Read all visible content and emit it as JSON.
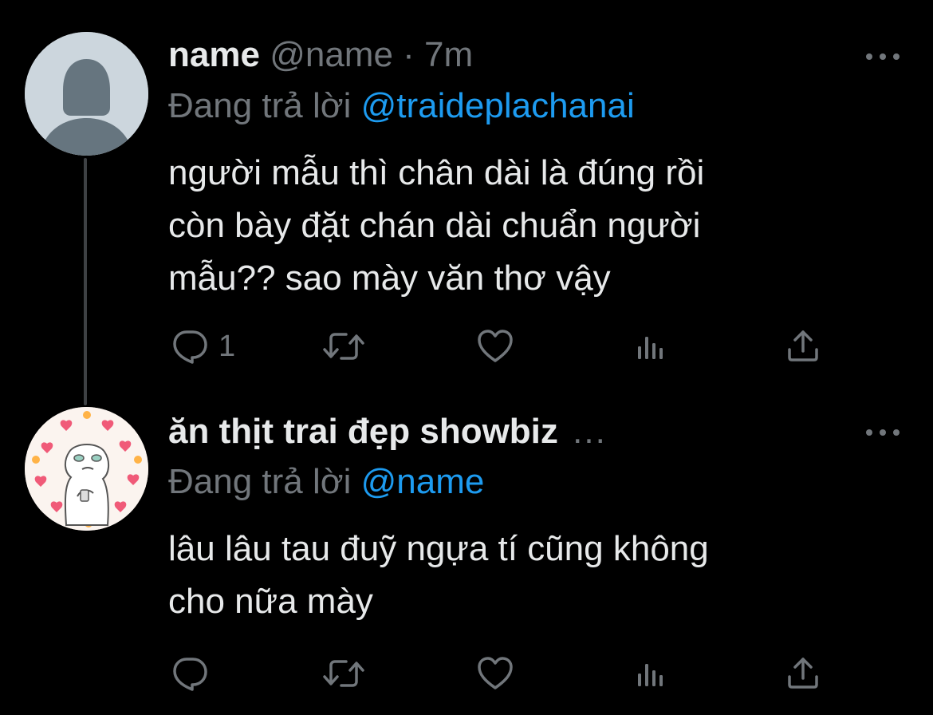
{
  "tweets": [
    {
      "display_name": "name",
      "handle": "@name",
      "separator": "·",
      "time": "7m",
      "replying_prefix": "Đang trả lời",
      "replying_to": "@traideplachanai",
      "lines": [
        "người mẫu thì chân dài là đúng rồi",
        "còn bày đặt chán dài chuẩn người",
        "mẫu?? sao mày văn thơ vậy"
      ],
      "reply_count": "1",
      "avatar": "default-profile-icon"
    },
    {
      "display_name": "ăn thịt trai đẹp showbiz",
      "truncation": "...",
      "replying_prefix": "Đang trả lời",
      "replying_to": "@name",
      "lines": [
        "lâu lâu tau đuỹ ngựa tí cũng không",
        "cho nữa mày"
      ],
      "avatar": "sticker-avatar"
    }
  ],
  "icons": {
    "reply": "reply-icon",
    "retweet": "retweet-icon",
    "like": "heart-icon",
    "views": "views-icon",
    "share": "share-icon",
    "more": "more-icon"
  },
  "colors": {
    "background": "#000000",
    "text": "#e7e9ea",
    "secondary": "#71767b",
    "accent": "#1d9bf0",
    "thread_line": "#3e4144",
    "avatar_default": "#ccd6dd",
    "avatar_silhouette": "#66757f"
  }
}
